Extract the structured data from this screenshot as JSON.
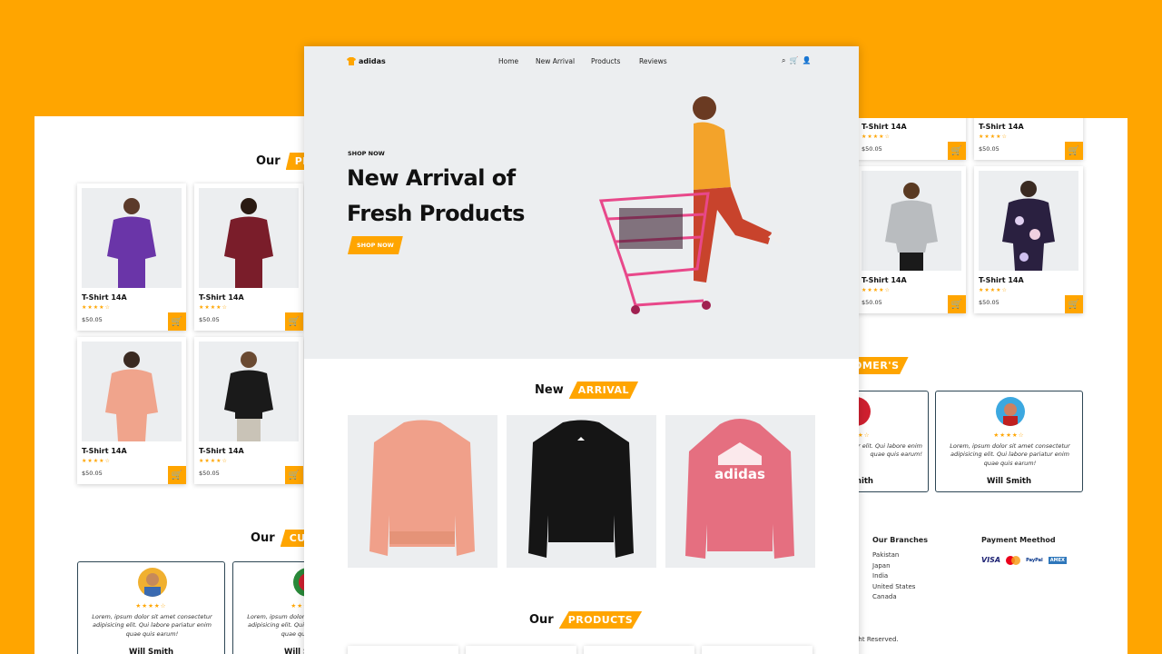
{
  "brand": {
    "name": "adidas"
  },
  "nav": {
    "items": [
      "Home",
      "New Arrival",
      "Products",
      "Reviews"
    ]
  },
  "hero": {
    "kicker": "SHOP NOW",
    "title_line1": "New Arrival of",
    "title_line2": "Fresh Products",
    "button": "SHOP NOW"
  },
  "sections": {
    "new_arrival": {
      "word": "New",
      "tag": "ARRIVAL"
    },
    "products": {
      "word": "Our",
      "tag": "PRODUCTS",
      "tag_left_partial": "PR"
    },
    "customers": {
      "word": "Our",
      "tag_left_partial": "CUS",
      "tag_right_partial": "TOMER'S"
    }
  },
  "product": {
    "name": "T-Shirt 14A",
    "price": "$50.05",
    "rating": 4.5
  },
  "left_products": [
    {
      "name": "T-Shirt 14A",
      "price": "$50.05",
      "color": "#6a35a8"
    },
    {
      "name": "T-Shirt 14A",
      "price": "$50.05",
      "color": "#7a1d2a"
    },
    {
      "name": "T-Shirt 14A",
      "price": "$50.05",
      "color": "#f0a48c"
    },
    {
      "name": "T-Shirt 14A",
      "price": "$50.05",
      "color": "#1a1a1a"
    }
  ],
  "right_products": [
    {
      "name": "T-Shirt 14A",
      "price": "$50.05"
    },
    {
      "name": "T-Shirt 14A",
      "price": "$50.05"
    },
    {
      "name": "T-Shirt 14A",
      "price": "$50.05",
      "color": "#b9bcbf"
    },
    {
      "name": "T-Shirt 14A",
      "price": "$50.05",
      "color": "#2a2040"
    }
  ],
  "new_arrivals": [
    {
      "color": "#f0a08a"
    },
    {
      "color": "#151515"
    },
    {
      "color": "#e56f80",
      "logo": "adidas"
    }
  ],
  "reviews": {
    "text": "Lorem, ipsum dolor sit amet consectetur adipisicing elit. Qui labore pariatur enim quae quis earum!",
    "right_partial_text": "it amet consectetur elit. Qui labore enim quae quis earum!",
    "right_partial_name": "nith",
    "name": "Will Smith"
  },
  "footer": {
    "branches_title": "Our Branches",
    "branches": [
      "Pakistan",
      "Japan",
      "India",
      "United States",
      "Canada"
    ],
    "payment_title": "Payment Meethod",
    "payment_cards": [
      "VISA",
      "PayPal",
      "AMEX"
    ],
    "copyright_partial": "l Right Reserved."
  },
  "colors": {
    "background": "#ffa500",
    "accent": "#ffa500",
    "hero_bg": "#eceef0",
    "review_border": "#2d4654"
  }
}
